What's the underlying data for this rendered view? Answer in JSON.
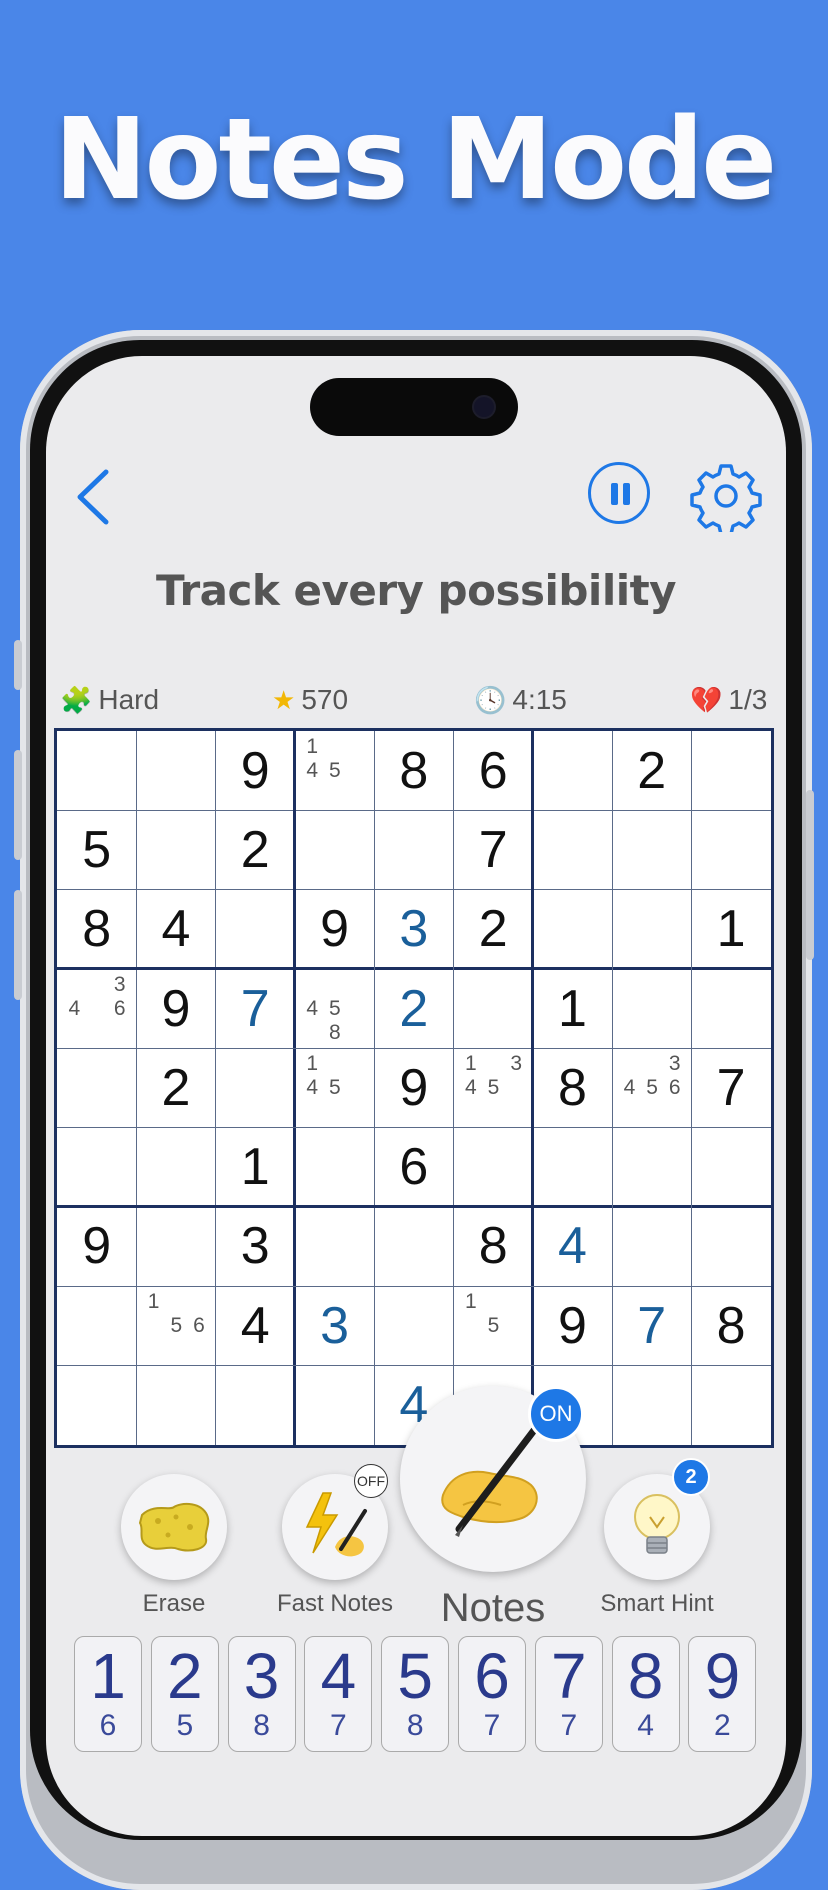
{
  "headline": "Notes Mode",
  "subtitle": "Track every possibility",
  "stats": {
    "difficulty": "Hard",
    "score": "570",
    "time": "4:15",
    "mistakes": "1/3"
  },
  "grid": {
    "rows": [
      [
        "",
        "",
        "9",
        "",
        "8",
        "6",
        "",
        "2",
        ""
      ],
      [
        "5",
        "",
        "2",
        "",
        "",
        "7",
        "",
        "",
        ""
      ],
      [
        "8",
        "4",
        "",
        "9",
        "3",
        "2",
        "",
        "",
        "1"
      ],
      [
        "",
        "9",
        "7",
        "",
        "2",
        "",
        "1",
        "",
        ""
      ],
      [
        "",
        "2",
        "",
        "",
        "9",
        "",
        "8",
        "",
        "7"
      ],
      [
        "",
        "",
        "1",
        "",
        "6",
        "",
        "",
        "",
        ""
      ],
      [
        "9",
        "",
        "3",
        "",
        "",
        "8",
        "4",
        "",
        ""
      ],
      [
        "",
        "",
        "4",
        "3",
        "",
        "",
        "9",
        "7",
        "8"
      ],
      [
        "",
        "",
        "",
        "",
        "4",
        "",
        "",
        "",
        ""
      ]
    ],
    "user_cells": [
      "2,4",
      "3,2",
      "3,4",
      "6,6",
      "7,3",
      "7,7",
      "8,4"
    ],
    "notes": {
      "0,3": [
        "1",
        "4",
        "5"
      ],
      "3,0": [
        "3",
        "4",
        "6"
      ],
      "3,3": [
        "4",
        "5",
        "8"
      ],
      "4,3": [
        "1",
        "4",
        "5"
      ],
      "4,5": [
        "1",
        "3",
        "4",
        "5"
      ],
      "4,7": [
        "3",
        "4",
        "5",
        "6"
      ],
      "7,1": [
        "1",
        "5",
        "6"
      ],
      "7,5": [
        "1",
        "5"
      ]
    }
  },
  "tools": {
    "erase": "Erase",
    "fast_notes": "Fast Notes",
    "fast_notes_state": "OFF",
    "notes": "Notes",
    "notes_state": "ON",
    "smart_hint": "Smart Hint",
    "smart_hint_count": "2"
  },
  "numpad": [
    {
      "digit": "1",
      "remaining": "6"
    },
    {
      "digit": "2",
      "remaining": "5"
    },
    {
      "digit": "3",
      "remaining": "8"
    },
    {
      "digit": "4",
      "remaining": "7"
    },
    {
      "digit": "5",
      "remaining": "8"
    },
    {
      "digit": "6",
      "remaining": "7"
    },
    {
      "digit": "7",
      "remaining": "7"
    },
    {
      "digit": "8",
      "remaining": "4"
    },
    {
      "digit": "9",
      "remaining": "2"
    }
  ],
  "colors": {
    "background": "#4a86e8",
    "accent": "#1e78e6",
    "grid_border": "#1c3060",
    "user_digit": "#1a5f9a",
    "numpad_digit": "#2a3a8c"
  }
}
